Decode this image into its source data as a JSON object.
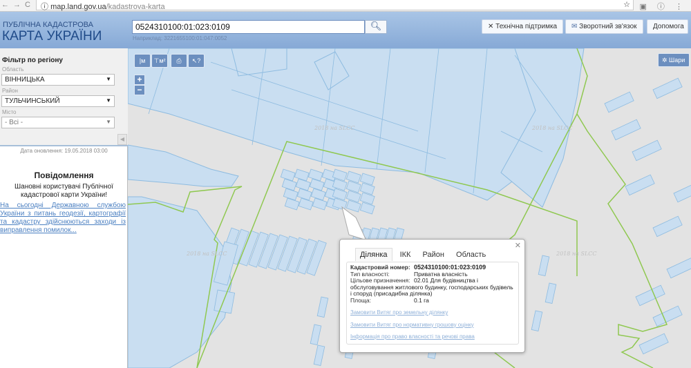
{
  "browser": {
    "url_host": "map.land.gov.ua",
    "url_path": "/kadastrova-karta"
  },
  "header": {
    "title_line1": "ПУБЛІЧНА КАДАСТРОВА",
    "title_line2": "КАРТА УКРАЇНИ",
    "search_value": "0524310100:01:023:0109",
    "search_hint": "Наприклад: 3221655100:01:047:0052",
    "buttons": {
      "support": "Технічна підтримка",
      "feedback": "Зворотний зв'язок",
      "help": "Допомога"
    }
  },
  "sidebar": {
    "filter_title": "Фільтр по регіону",
    "oblast_label": "Область",
    "oblast_value": "ВІННИЦЬКА",
    "raion_label": "Район",
    "raion_value": "ТУЛЬЧИНСЬКИЙ",
    "misto_label": "Місто",
    "misto_value": "- Всі -",
    "update_date": "Дата оновлення: 19.05.2018 03:00",
    "notice_title": "Повідомлення",
    "notice_text": "Шановні користувачі Публічної кадастрової карти України!",
    "notice_link": "На сьогодні Державною службою України з питань геодезії, картографії та кадастру здійснюються заходи із виправлення помилок..."
  },
  "map": {
    "toolbar": {
      "ruler": "|м",
      "area": "⊤м²",
      "print": "print",
      "identify": "?"
    },
    "zoom_in": "+",
    "zoom_out": "−",
    "layers_label": "Шари",
    "watermark": "2018 на SLCC",
    "colors": {
      "parcel_fill": "#c9def1",
      "parcel_stroke": "#8dbbe0",
      "boundary": "#8fc850",
      "background": "#e3e3e3"
    }
  },
  "popup": {
    "tabs": [
      "Ділянка",
      "ІКК",
      "Район",
      "Область"
    ],
    "fields": [
      {
        "key": "Кадастровий номер:",
        "value": "0524310100:01:023:0109"
      },
      {
        "key": "Тип власності:",
        "value": "Приватна власність"
      },
      {
        "key": "Цільове призначення:",
        "value": "02.01 Для будівництва і обслуговування житлового будинку, господарських будівель і споруд (присадибна ділянка)"
      },
      {
        "key": "Площа:",
        "value": "0.1 га"
      }
    ],
    "links": [
      "Замовити Витяг про земельну ділянку",
      "Замовити Витяг про нормативну грошову оцінку",
      "Інформація про право власності та речові права"
    ]
  }
}
